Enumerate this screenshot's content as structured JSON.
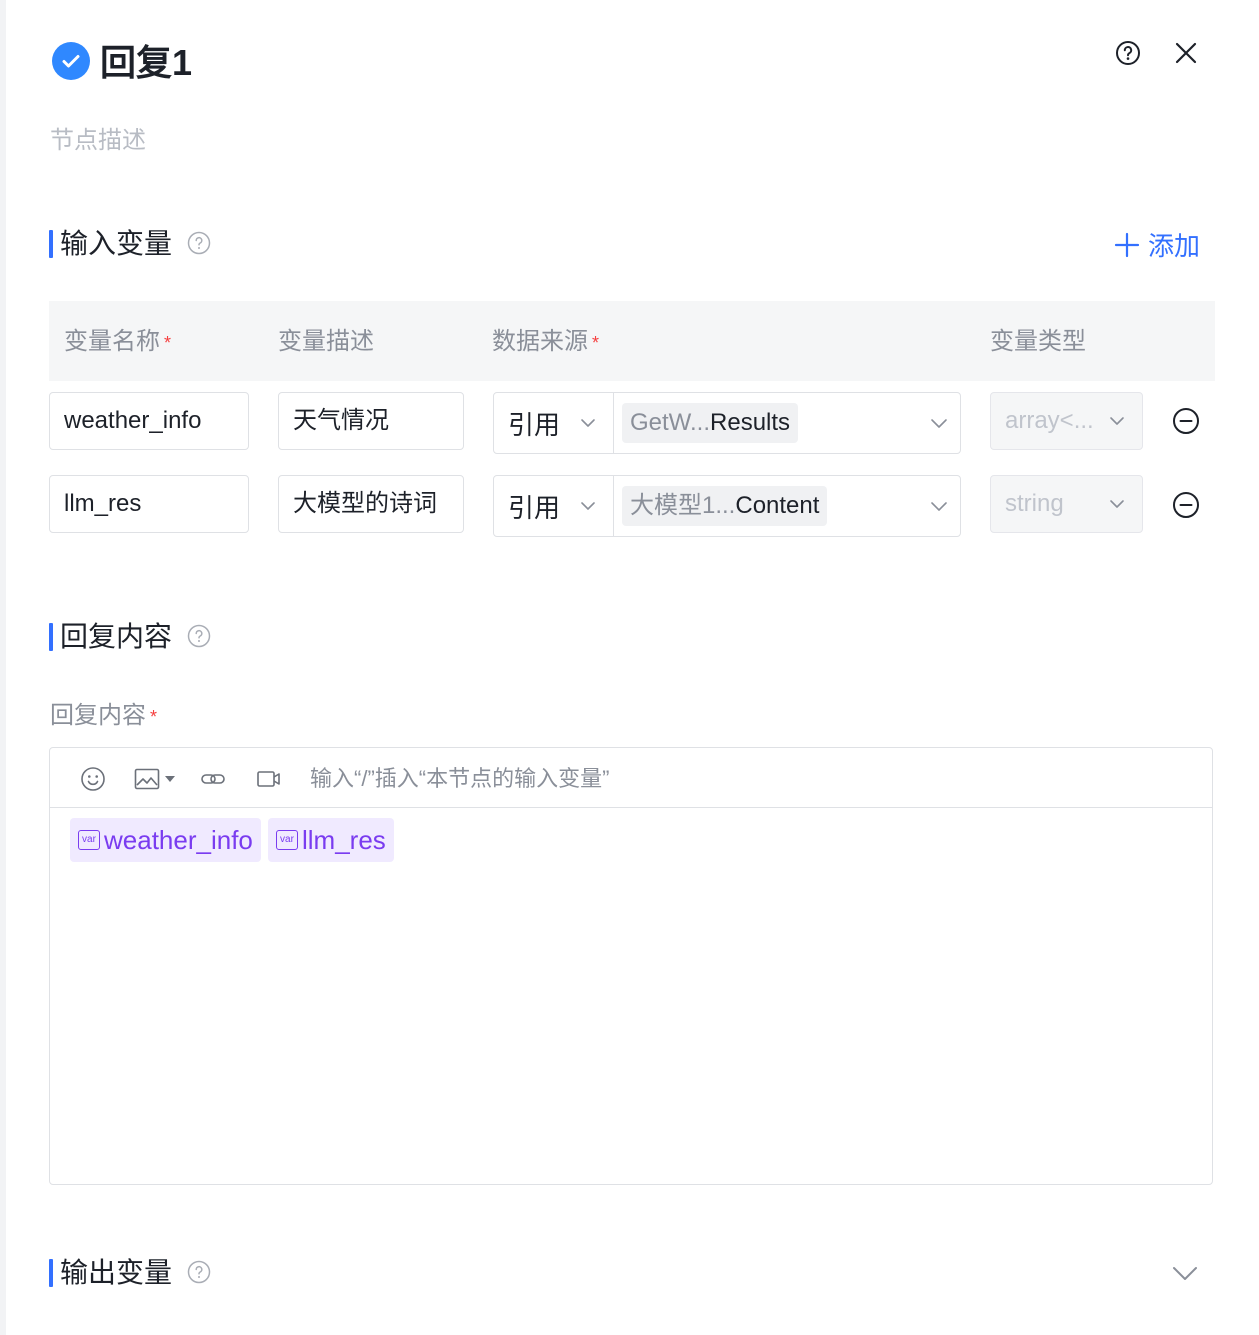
{
  "header": {
    "title": "回复1",
    "description_placeholder": "节点描述"
  },
  "input_section": {
    "title": "输入变量",
    "add_label": "添加",
    "columns": {
      "name": "变量名称",
      "desc": "变量描述",
      "source": "数据来源",
      "type": "变量类型",
      "required_mark": "*"
    },
    "rows": [
      {
        "name": "weather_info",
        "desc": "天气情况",
        "source_type": "引用",
        "source_prefix": "GetW...",
        "source_suffix": "Results",
        "var_type": "array<..."
      },
      {
        "name": "llm_res",
        "desc": "大模型的诗词",
        "source_type": "引用",
        "source_prefix": "大模型1...",
        "source_suffix": "Content",
        "var_type": "string"
      }
    ]
  },
  "reply_section": {
    "title": "回复内容",
    "field_label": "回复内容",
    "required_mark": "*",
    "placeholder": "输入“/”插入“本节点的输入变量”",
    "chips": [
      {
        "badge": "var",
        "label": "weather_info"
      },
      {
        "badge": "var",
        "label": "llm_res"
      }
    ]
  },
  "output_section": {
    "title": "输出变量"
  },
  "colors": {
    "accent": "#3370ff",
    "chip_bg": "#f0eaff",
    "chip_text": "#7a3cf0",
    "required": "#f53f3f"
  }
}
